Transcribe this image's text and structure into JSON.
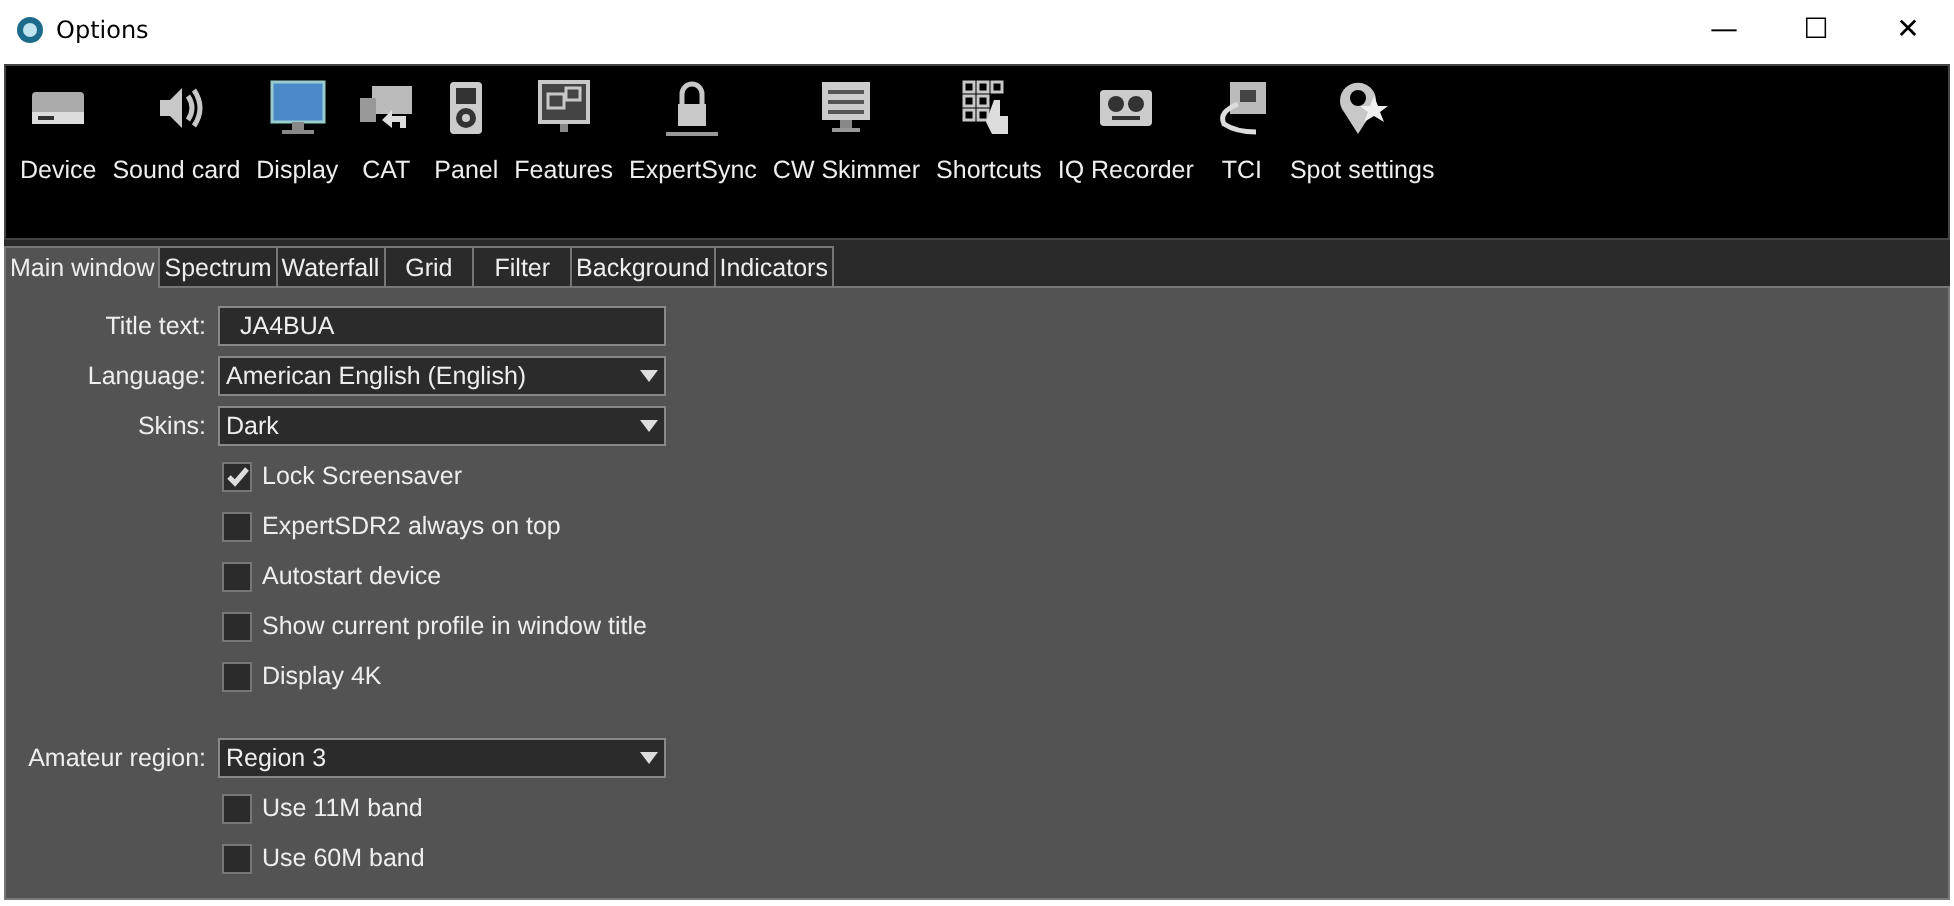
{
  "window": {
    "title": "Options",
    "controls": [
      "—",
      "☐",
      "✕"
    ]
  },
  "toolbar": [
    {
      "label": "Device"
    },
    {
      "label": "Sound card"
    },
    {
      "label": "Display"
    },
    {
      "label": "CAT"
    },
    {
      "label": "Panel"
    },
    {
      "label": "Features"
    },
    {
      "label": "ExpertSync"
    },
    {
      "label": "CW Skimmer"
    },
    {
      "label": "Shortcuts"
    },
    {
      "label": "IQ Recorder"
    },
    {
      "label": "TCI"
    },
    {
      "label": "Spot settings"
    }
  ],
  "tabs": [
    {
      "label": "Main window",
      "selected": true
    },
    {
      "label": "Spectrum",
      "selected": false
    },
    {
      "label": "Waterfall",
      "selected": false
    },
    {
      "label": "Grid",
      "selected": false
    },
    {
      "label": "Filter",
      "selected": false
    },
    {
      "label": "Background",
      "selected": false
    },
    {
      "label": "Indicators",
      "selected": false
    }
  ],
  "general": [
    {
      "kind": "text",
      "label": "Title text:",
      "value": "JA4BUA"
    },
    {
      "kind": "dropdown",
      "label": "Language:",
      "value": "American English (English)"
    },
    {
      "kind": "dropdown",
      "label": "Skins:",
      "value": "Dark"
    },
    {
      "kind": "checkbox",
      "label": "Lock Screensaver",
      "checked": true
    },
    {
      "kind": "checkbox",
      "label": "ExpertSDR2 always on top",
      "checked": false
    },
    {
      "kind": "checkbox",
      "label": "Autostart device",
      "checked": false
    },
    {
      "kind": "checkbox",
      "label": "Show current profile in window title",
      "checked": false
    },
    {
      "kind": "checkbox",
      "label": "Display 4K",
      "checked": false
    }
  ],
  "region": [
    {
      "kind": "dropdown",
      "label": "Amateur region:",
      "value": "Region 3"
    },
    {
      "kind": "checkbox",
      "label": "Use 11M band",
      "checked": false
    },
    {
      "kind": "checkbox",
      "label": "Use 60M band",
      "checked": false
    }
  ]
}
